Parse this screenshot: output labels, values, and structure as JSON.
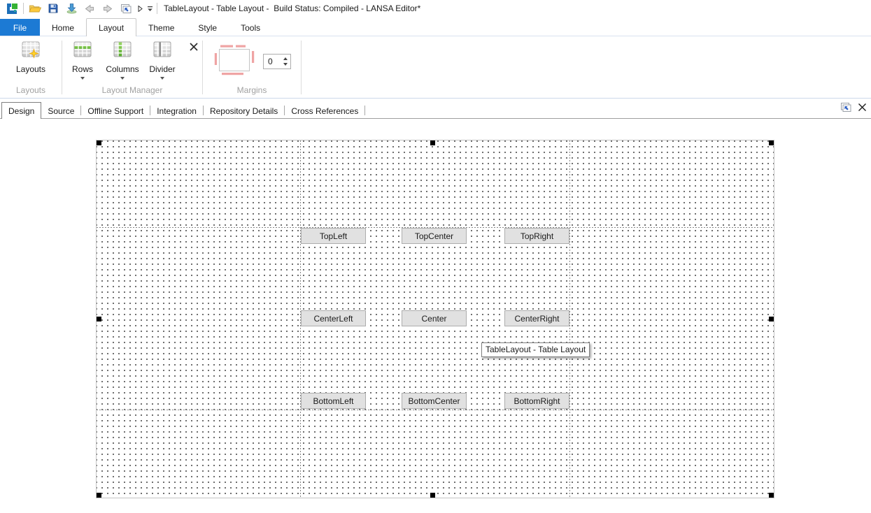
{
  "window": {
    "title": "TableLayout - Table Layout -  Build Status: Compiled - LANSA Editor*",
    "quick_access_icons": [
      "app-logo",
      "open-folder",
      "save",
      "check-in",
      "back",
      "forward",
      "switch-window",
      "play",
      "customize-toolbar"
    ]
  },
  "ribbon": {
    "active_tab": "Layout",
    "tabs": [
      {
        "label": "File"
      },
      {
        "label": "Home"
      },
      {
        "label": "Layout"
      },
      {
        "label": "Theme"
      },
      {
        "label": "Style"
      },
      {
        "label": "Tools"
      }
    ],
    "groups": {
      "layouts": {
        "label": "Layouts",
        "button": "Layouts"
      },
      "layout_manager": {
        "label": "Layout Manager",
        "rows": "Rows",
        "columns": "Columns",
        "divider": "Divider"
      },
      "margins": {
        "label": "Margins",
        "spinner_value": "0"
      }
    }
  },
  "document_tabs": [
    {
      "label": "Design",
      "active": true
    },
    {
      "label": "Source",
      "active": false
    },
    {
      "label": "Offline Support",
      "active": false
    },
    {
      "label": "Integration",
      "active": false
    },
    {
      "label": "Repository Details",
      "active": false
    },
    {
      "label": "Cross References",
      "active": false
    }
  ],
  "designer": {
    "tooltip": "TableLayout - Table Layout",
    "buttons": [
      {
        "label": "TopLeft"
      },
      {
        "label": "TopCenter"
      },
      {
        "label": "TopRight"
      },
      {
        "label": "CenterLeft"
      },
      {
        "label": "Center"
      },
      {
        "label": "CenterRight"
      },
      {
        "label": "BottomLeft"
      },
      {
        "label": "BottomCenter"
      },
      {
        "label": "BottomRight"
      }
    ]
  },
  "colors": {
    "file_tab_blue": "#1c7ad4",
    "button_face": "#e1e1e1",
    "button_border": "#adadad",
    "accent_green": "#61b637",
    "margin_pink": "#efa4a4"
  }
}
